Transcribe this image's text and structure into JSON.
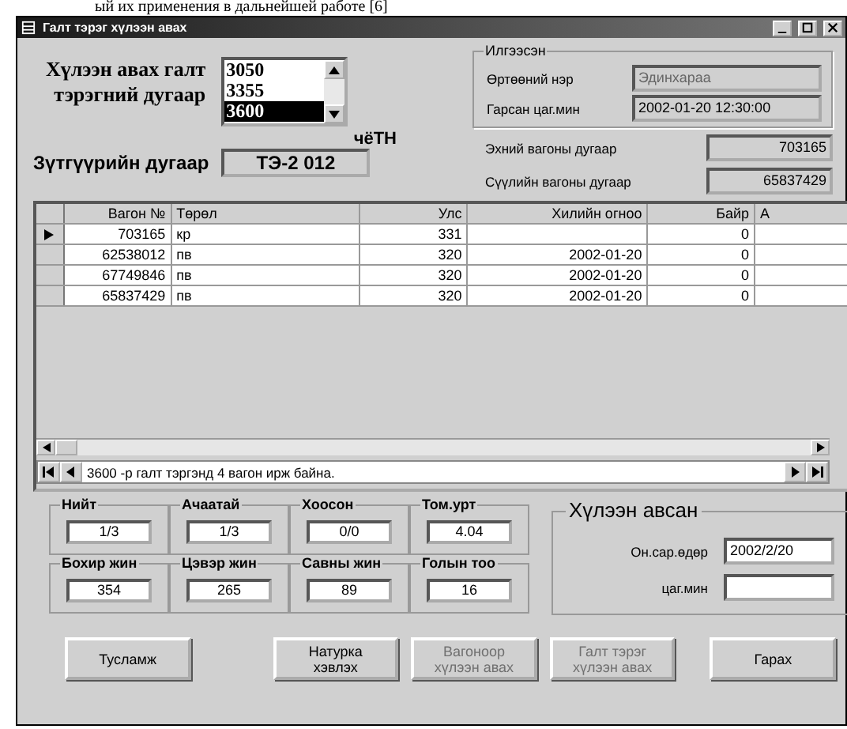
{
  "document_line": "ый их применения в дальнейшей работе [6]",
  "window": {
    "title": "Галт тэрэг хүлээн авах"
  },
  "train_select": {
    "label_lines": [
      "Хүлээн авах галт",
      "тэрэгний дугаар"
    ],
    "items": [
      {
        "text": "3050",
        "selected": false
      },
      {
        "text": "3355",
        "selected": false
      },
      {
        "text": "3600",
        "selected": true
      }
    ]
  },
  "parity": "чёТН",
  "locomotive": {
    "label": "Зүтгүүрийн дугаар",
    "value": "ТЭ-2  012"
  },
  "sent": {
    "title": "Илгээсэн",
    "fields": [
      {
        "label": "Өртөөний нэр",
        "value": "Эдинхараа",
        "disabled": true
      },
      {
        "label": "Гарсан цаг.мин",
        "value": "2002-01-20 12:30:00",
        "disabled": false
      }
    ]
  },
  "wagon_numbers": [
    {
      "label": "Эхний вагоны дугаар",
      "value": "703165"
    },
    {
      "label": "Сүүлийн вагоны дугаар",
      "value": "65837429"
    }
  ],
  "table": {
    "columns": [
      {
        "label": "Вагон №",
        "kind": "number"
      },
      {
        "label": "Төрөл",
        "kind": "text"
      },
      {
        "label": "Улс",
        "kind": "number"
      },
      {
        "label": "Хилийн огноо",
        "kind": "number"
      },
      {
        "label": "Байр",
        "kind": "number"
      },
      {
        "label": "А",
        "kind": "text"
      }
    ],
    "rows": [
      {
        "selected": true,
        "cells": [
          "703165",
          "кр",
          "331",
          "",
          "0",
          ""
        ]
      },
      {
        "selected": false,
        "cells": [
          "62538012",
          "пв",
          "320",
          "2002-01-20",
          "0",
          ""
        ]
      },
      {
        "selected": false,
        "cells": [
          "67749846",
          "пв",
          "320",
          "2002-01-20",
          "0",
          ""
        ]
      },
      {
        "selected": false,
        "cells": [
          "65837429",
          "пв",
          "320",
          "2002-01-20",
          "0",
          ""
        ]
      }
    ]
  },
  "status": "3600 -р галт тэргэнд 4 вагон ирж байна.",
  "totals": [
    {
      "label": "Нийт",
      "value": "1/3"
    },
    {
      "label": "Ачаатай",
      "value": "1/3"
    },
    {
      "label": "Хоосон",
      "value": "0/0"
    },
    {
      "label": "Том.урт",
      "value": "4.04"
    },
    {
      "label": "Бохир жин",
      "value": "354"
    },
    {
      "label": "Цэвэр жин",
      "value": "265"
    },
    {
      "label": "Савны жин",
      "value": "89"
    },
    {
      "label": "Голын тоо",
      "value": "16"
    }
  ],
  "received": {
    "title": "Хүлээн авсан",
    "fields": [
      {
        "label": "Он.сар.өдөр",
        "value": "2002/2/20"
      },
      {
        "label": "цаг.мин"
      }
    ]
  },
  "buttons": [
    {
      "lines": [
        "Тусламж"
      ],
      "disabled": false
    },
    {
      "lines": [
        "Натурка",
        "хэвлэх"
      ],
      "disabled": false
    },
    {
      "lines": [
        "Вагоноор",
        "хүлээн авах"
      ],
      "disabled": true
    },
    {
      "lines": [
        "Галт тэрэг",
        "хүлээн авах"
      ],
      "disabled": true
    },
    {
      "lines": [
        "Гарах"
      ],
      "disabled": false
    }
  ]
}
